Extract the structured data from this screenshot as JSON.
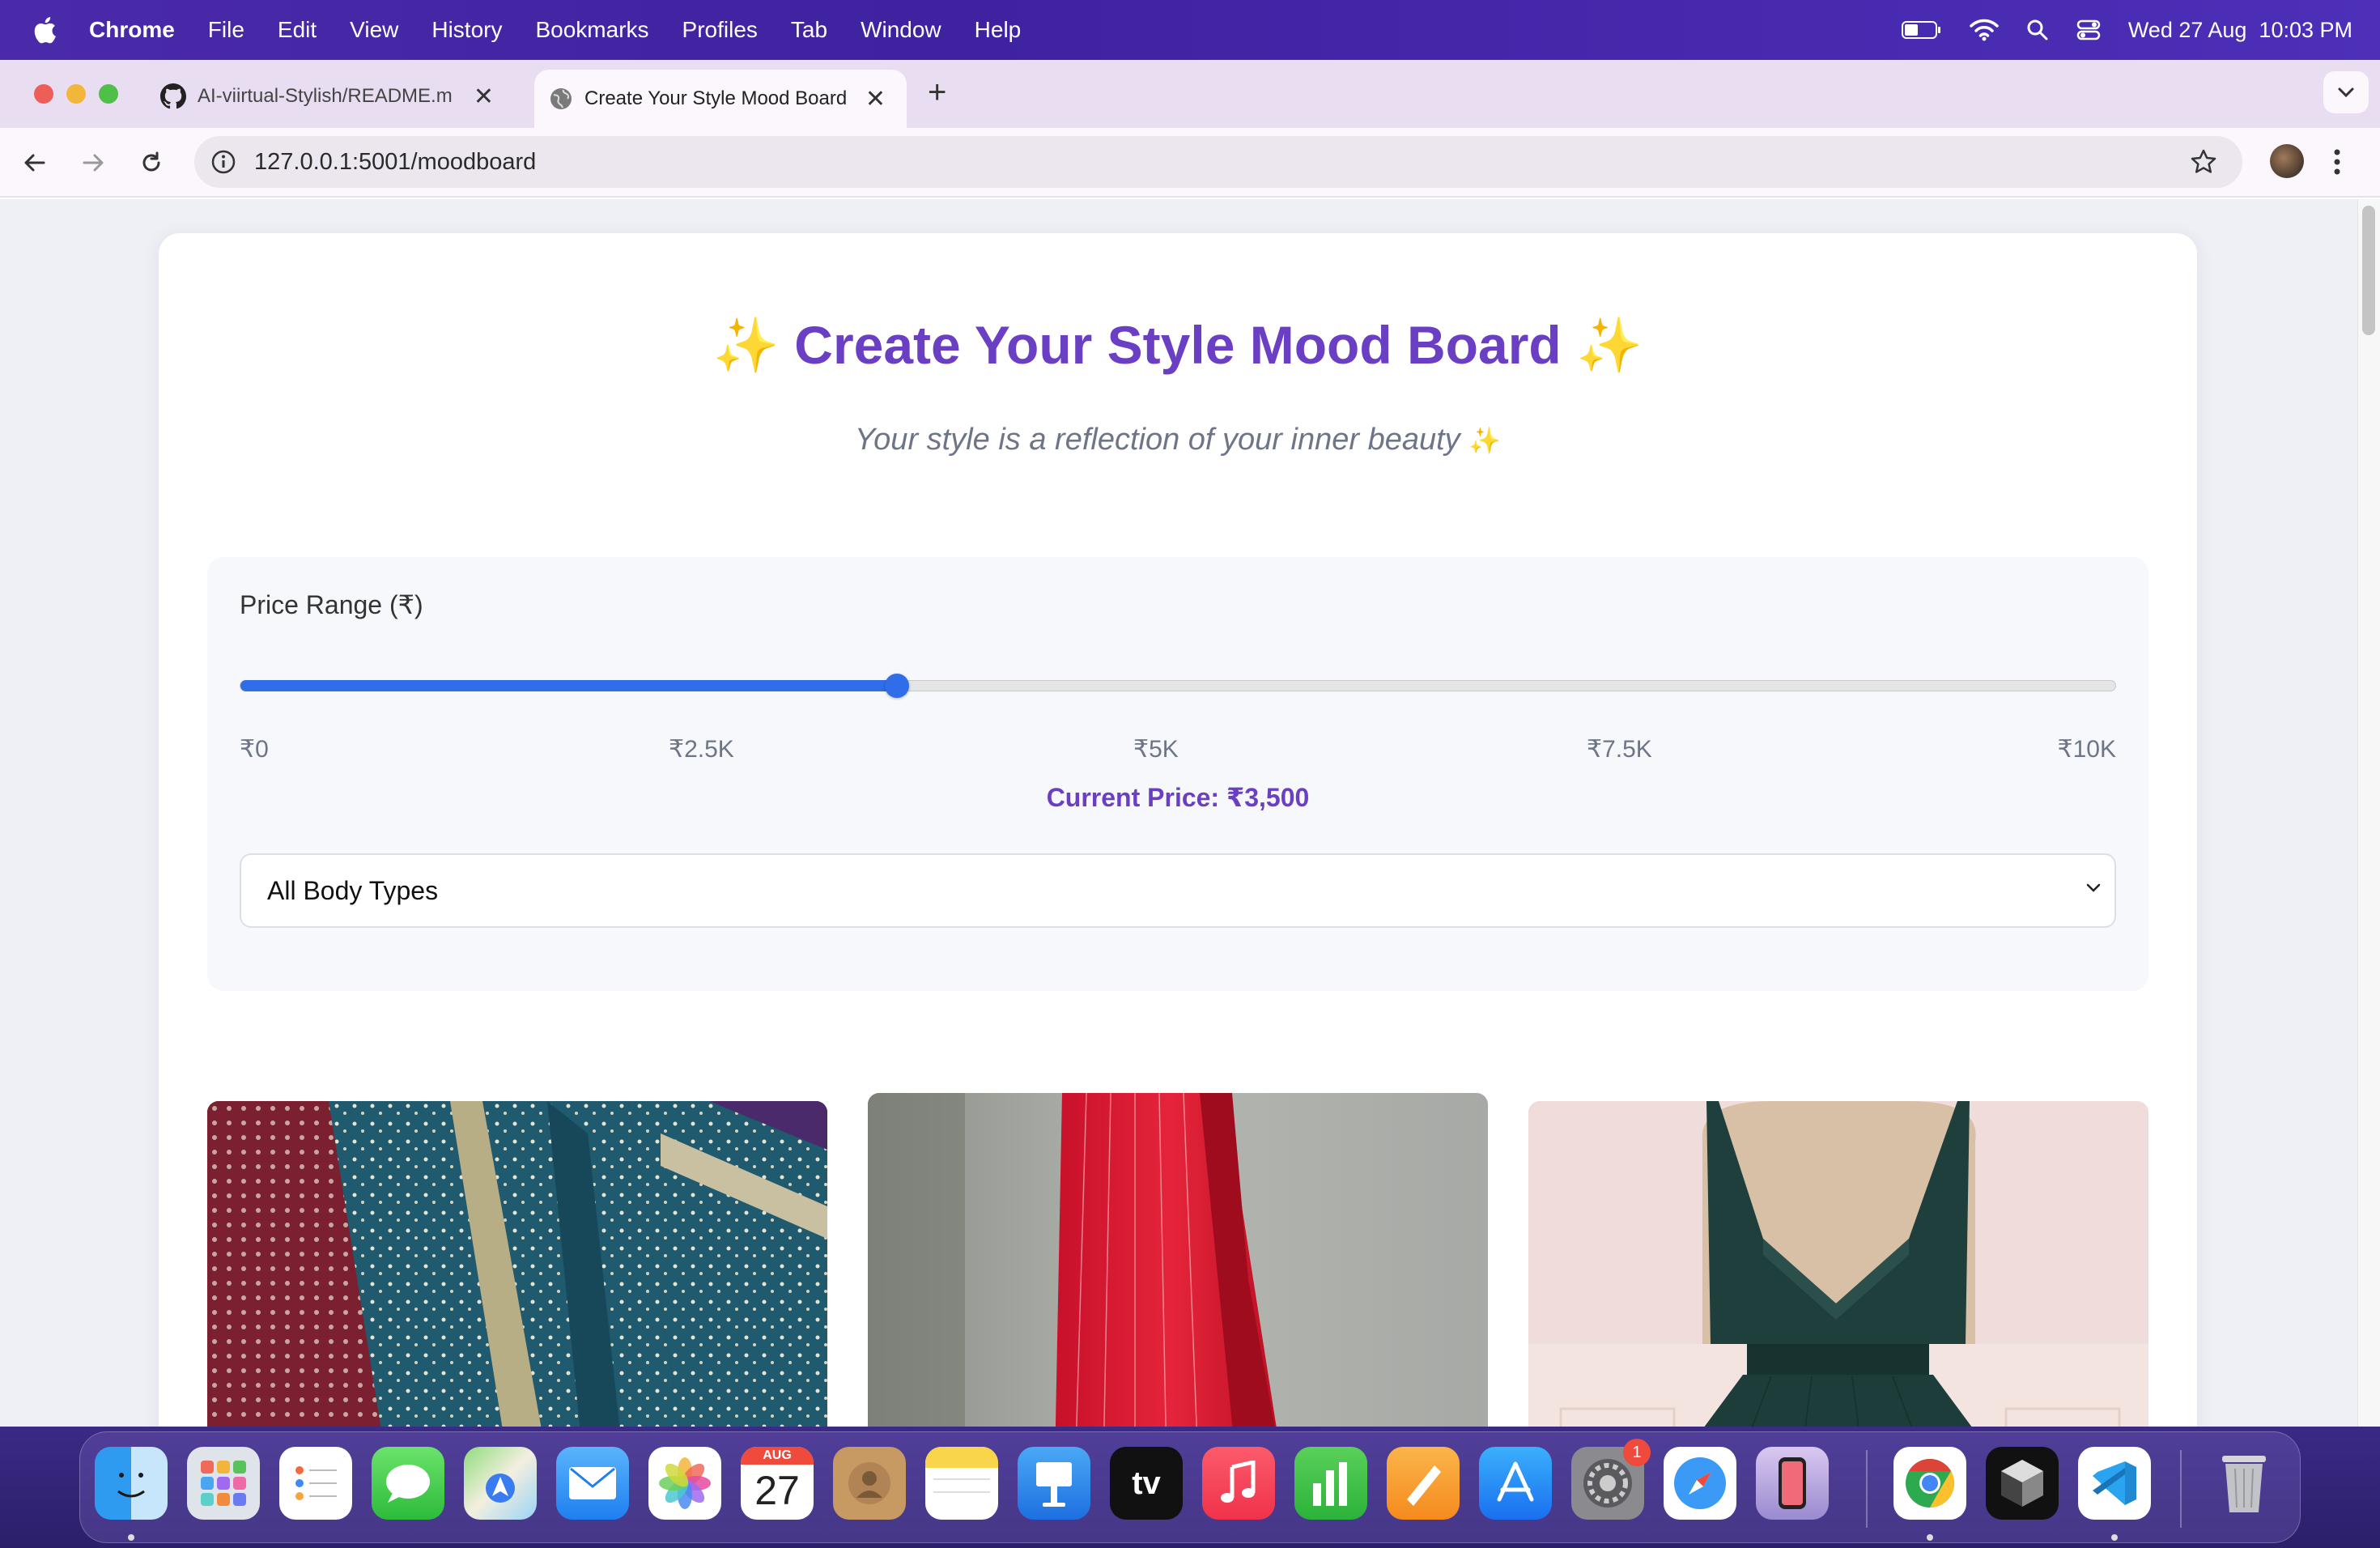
{
  "menubar": {
    "app_name": "Chrome",
    "items": [
      "File",
      "Edit",
      "View",
      "History",
      "Bookmarks",
      "Profiles",
      "Tab",
      "Window",
      "Help"
    ],
    "datetime": "Wed 27 Aug  10:03 PM"
  },
  "browser": {
    "tabs": [
      {
        "title": "AI-viirtual-Stylish/README.m",
        "icon": "github-icon"
      },
      {
        "title": "Create Your Style Mood Board",
        "icon": "globe-icon"
      }
    ],
    "url": "127.0.0.1:5001/moodboard"
  },
  "page": {
    "title": "Create Your Style Mood Board",
    "title_sparkle": "✨",
    "subtitle": "Your style is a reflection of your inner beauty",
    "subtitle_sparkle": "✨",
    "price": {
      "label": "Price Range (₹)",
      "min": 0,
      "max": 10000,
      "value": 3500,
      "ticks": [
        "₹0",
        "₹2.5K",
        "₹5K",
        "₹7.5K",
        "₹10K"
      ],
      "current_label": "Current Price: ₹3,500",
      "fill_color": "#2f6ee8"
    },
    "body_type_select": {
      "value": "All Body Types"
    },
    "accent_color": "#6b3fc3",
    "sparkle_color": "#f2c331"
  },
  "dock": {
    "calendar_month": "AUG",
    "calendar_day": "27",
    "settings_badge": "1",
    "apps": [
      "finder-icon",
      "launchpad-icon",
      "reminders-icon",
      "messages-icon",
      "maps-icon",
      "mail-icon",
      "photos-icon",
      "calendar-icon",
      "contacts-icon",
      "notes-icon",
      "keynote-icon",
      "tv-icon",
      "music-icon",
      "numbers-icon",
      "pages-icon",
      "app-store-icon",
      "system-settings-icon",
      "safari-icon",
      "iphone-mirroring-icon",
      "chrome-icon",
      "cursor-app-icon",
      "vscode-icon",
      "trash-icon"
    ]
  }
}
